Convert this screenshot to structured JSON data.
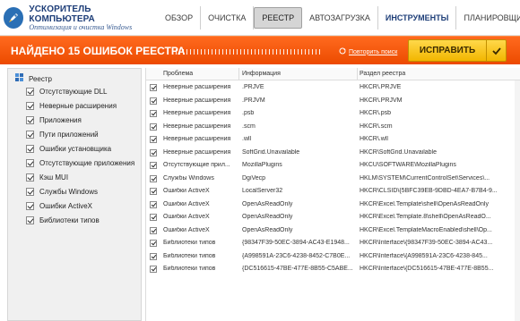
{
  "app": {
    "title": "УСКОРИТЕЛЬ КОМПЬЮТЕРА",
    "subtitle": "Оптимизация и очистка Windows"
  },
  "nav": {
    "items": [
      {
        "label": "ОБЗОР"
      },
      {
        "label": "ОЧИСТКА"
      },
      {
        "label": "РЕЕСТР"
      },
      {
        "label": "АВТОЗАГРУЗКА"
      },
      {
        "label": "ИНСТРУМЕНТЫ"
      },
      {
        "label": "ПЛАНИРОВЩИК"
      }
    ],
    "active": "РЕЕСТР"
  },
  "bar": {
    "title": "НАЙДЕНО 15 ОШИБОК РЕЕСТРА",
    "repeat_link": "Повторить поиск",
    "fix_label": "ИСПРАВИТЬ",
    "color": "#f0560a"
  },
  "sidebar": {
    "root": "Реестр",
    "items": [
      "Отсутствующие DLL",
      "Неверные расширения",
      "Приложения",
      "Пути приложений",
      "Ошибки установщика",
      "Отсутствующие приложения",
      "Кэш MUI",
      "Службы Windows",
      "Ошибки ActiveX",
      "Библиотеки типов"
    ]
  },
  "table": {
    "headers": [
      "Проблема",
      "Информация",
      "Раздел реестра"
    ],
    "rows": [
      [
        "Неверные расширения",
        ".PRJVE",
        "HKCR\\.PRJVE"
      ],
      [
        "Неверные расширения",
        ".PRJVM",
        "HKCR\\.PRJVM"
      ],
      [
        "Неверные расширения",
        ".psb",
        "HKCR\\.psb"
      ],
      [
        "Неверные расширения",
        ".scm",
        "HKCR\\.scm"
      ],
      [
        "Неверные расширения",
        ".wll",
        "HKCR\\.wll"
      ],
      [
        "Неверные расширения",
        "SoftGrid.Unavailable",
        "HKCR\\SoftGrid.Unavailable"
      ],
      [
        "Отсутствующие прил...",
        "MozillaPlugins",
        "HKCU\\SOFTWARE\\MozillaPlugins"
      ],
      [
        "Службы Windows",
        "DgiVecp",
        "HKLM\\SYSTEM\\CurrentControlSet\\Services\\..."
      ],
      [
        "Ошибки ActiveX",
        "LocalServer32",
        "HKCR\\CLSID\\{5BFC39EB-9DBD-4EA7-B7B4-9..."
      ],
      [
        "Ошибки ActiveX",
        "OpenAsReadOnly",
        "HKCR\\Excel.Template\\shell\\OpenAsReadOnly"
      ],
      [
        "Ошибки ActiveX",
        "OpenAsReadOnly",
        "HKCR\\Excel.Template.8\\shell\\OpenAsReadO..."
      ],
      [
        "Ошибки ActiveX",
        "OpenAsReadOnly",
        "HKCR\\Excel.TemplateMacroEnabled\\shell\\Op..."
      ],
      [
        "Библиотеки типов",
        "{98347F39-50EC-3894-AC43-E1948...",
        "HKCR\\Interface\\{98347F39-50EC-3894-AC43..."
      ],
      [
        "Библиотеки типов",
        "{A998591A-23C6-4238-8452-C7B0E...",
        "HKCR\\Interface\\{A998591A-23C6-4238-845..."
      ],
      [
        "Библиотеки типов",
        "{DC516615-47BE-477E-8B55-C5ABE...",
        "HKCR\\Interface\\{DC516615-47BE-477E-8B55..."
      ]
    ]
  }
}
